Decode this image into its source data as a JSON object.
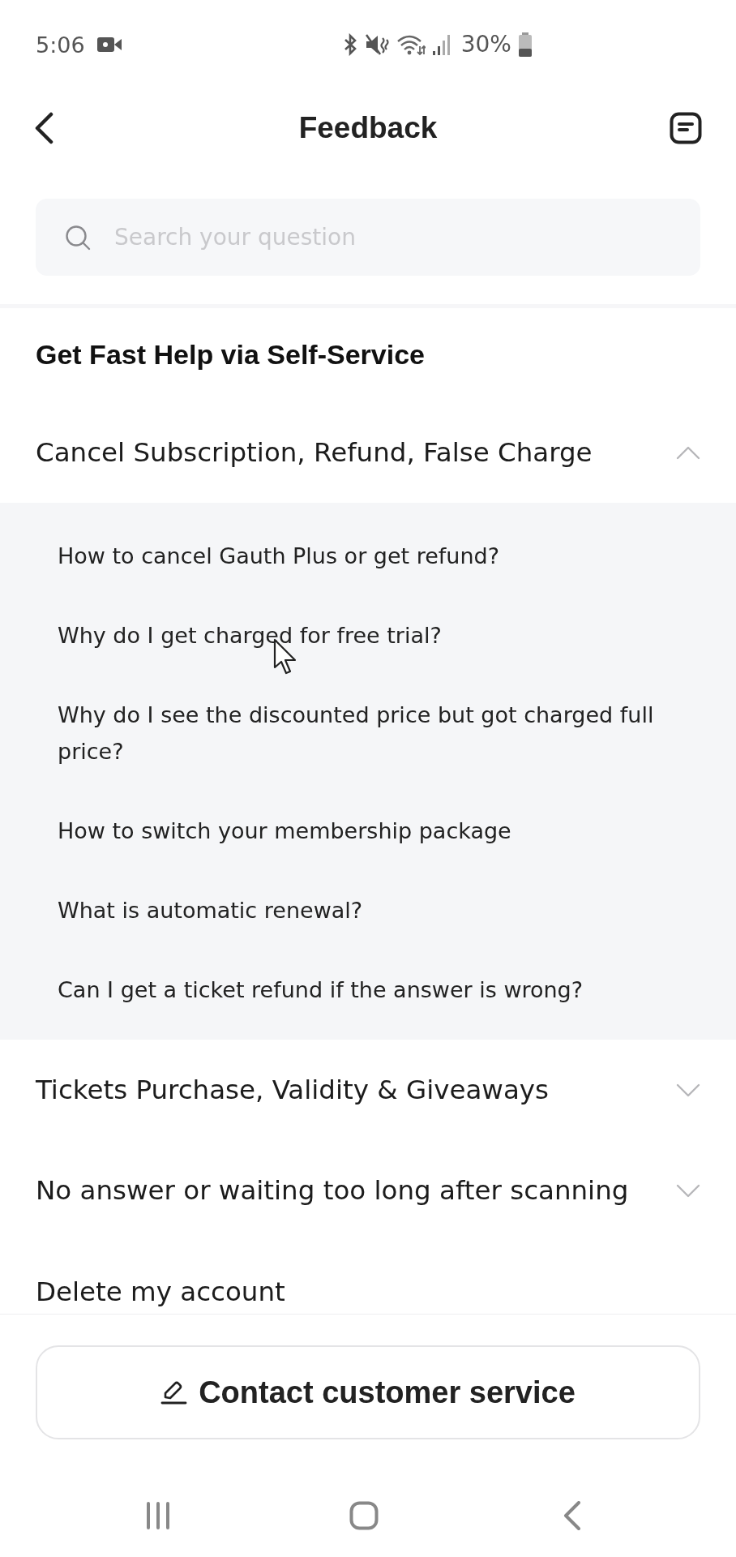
{
  "status_bar": {
    "time": "5:06",
    "battery_text": "30%"
  },
  "header": {
    "title": "Feedback"
  },
  "search": {
    "placeholder": "Search your question"
  },
  "self_service": {
    "title": "Get Fast Help via Self-Service",
    "categories": [
      {
        "kind": "accordion",
        "label": "Cancel Subscription, Refund, False Charge",
        "expanded": true,
        "questions": [
          "How to cancel Gauth Plus or get refund?",
          "Why do I get charged for free trial?",
          "Why do I see the discounted price but got charged full price?",
          "How to switch your membership package",
          "What is automatic renewal?",
          "Can I get a ticket refund if the answer is wrong?"
        ]
      },
      {
        "kind": "accordion",
        "label": "Tickets Purchase, Validity & Giveaways",
        "expanded": false
      },
      {
        "kind": "accordion",
        "label": "No answer or waiting too long after scanning",
        "expanded": false
      },
      {
        "kind": "plain",
        "label": "Delete my account"
      }
    ]
  },
  "contact_button": {
    "label": "Contact customer service"
  }
}
